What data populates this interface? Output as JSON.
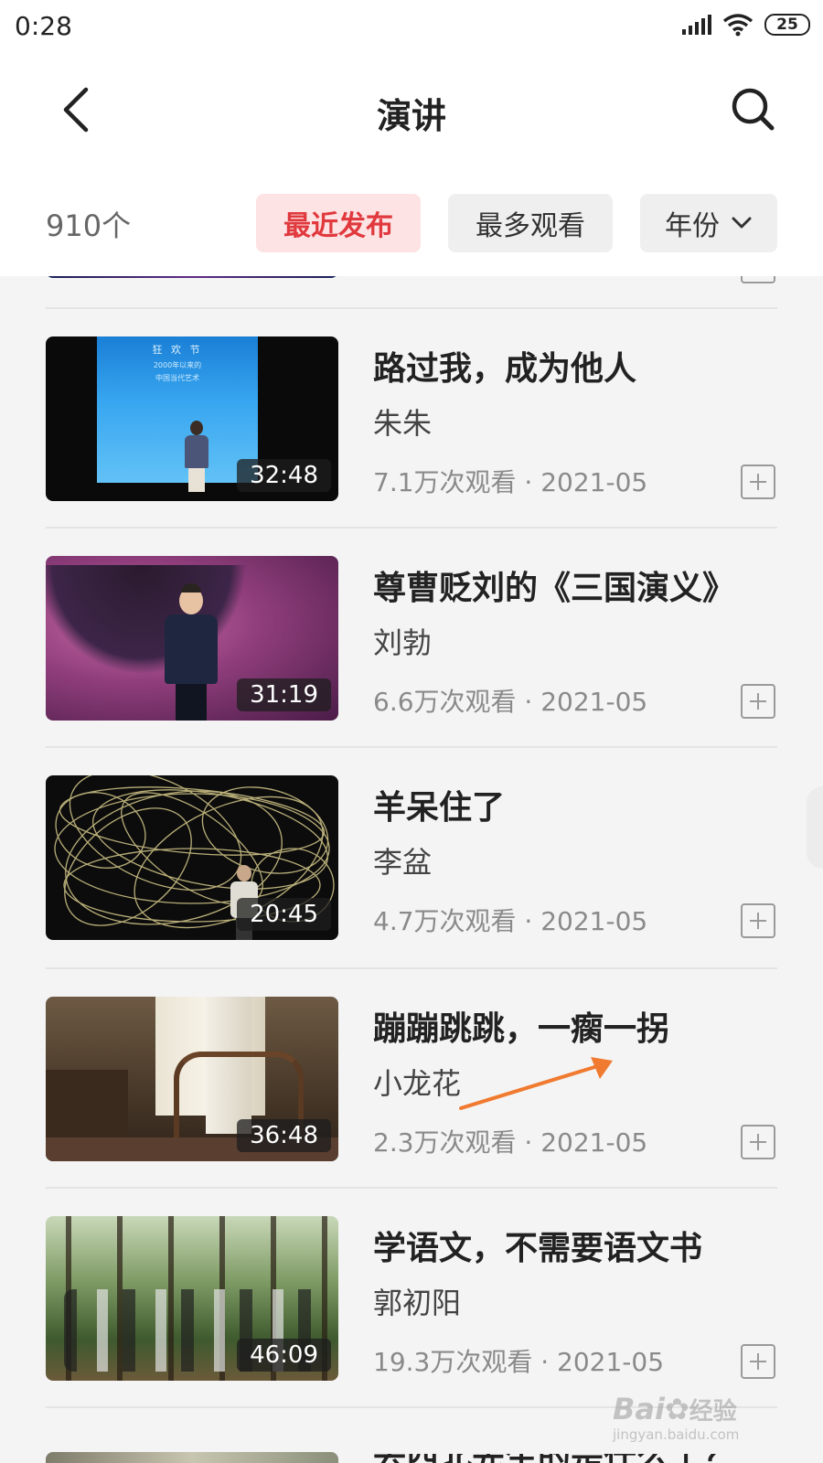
{
  "status_bar": {
    "time": "0:28",
    "battery": "25"
  },
  "header": {
    "title": "演讲"
  },
  "filters": {
    "count": "910个",
    "recent": "最近发布",
    "most_viewed": "最多观看",
    "year": "年份"
  },
  "videos": [
    {
      "title": "路过我，成为他人",
      "author": "朱朱",
      "meta": "7.1万次观看 · 2021-05",
      "duration": "32:48"
    },
    {
      "title": "尊曹贬刘的《三国演义》",
      "author": "刘勃",
      "meta": "6.6万次观看 · 2021-05",
      "duration": "31:19"
    },
    {
      "title": "羊呆住了",
      "author": "李盆",
      "meta": "4.7万次观看 · 2021-05",
      "duration": "20:45"
    },
    {
      "title": "蹦蹦跳跳，一瘸一拐",
      "author": "小龙花",
      "meta": "2.3万次观看 · 2021-05",
      "duration": "36:48"
    },
    {
      "title": "学语文，不需要语文书",
      "author": "郭初阳",
      "meta": "19.3万次观看 · 2021-05",
      "duration": "46:09"
    }
  ],
  "partial_next": {
    "title": "去西北先生的是什么了？"
  },
  "thumb_stage_text": {
    "line1": "狂 欢 节",
    "line2": "2000年以来的",
    "line3": "中国当代艺术"
  },
  "watermark": {
    "brand": "Bai",
    "brand_cn": "经验",
    "url": "jingyan.baidu.com"
  },
  "colors": {
    "accent": "#e0393e",
    "chip_active_bg": "#fde3e3",
    "arrow": "#f07a30"
  }
}
